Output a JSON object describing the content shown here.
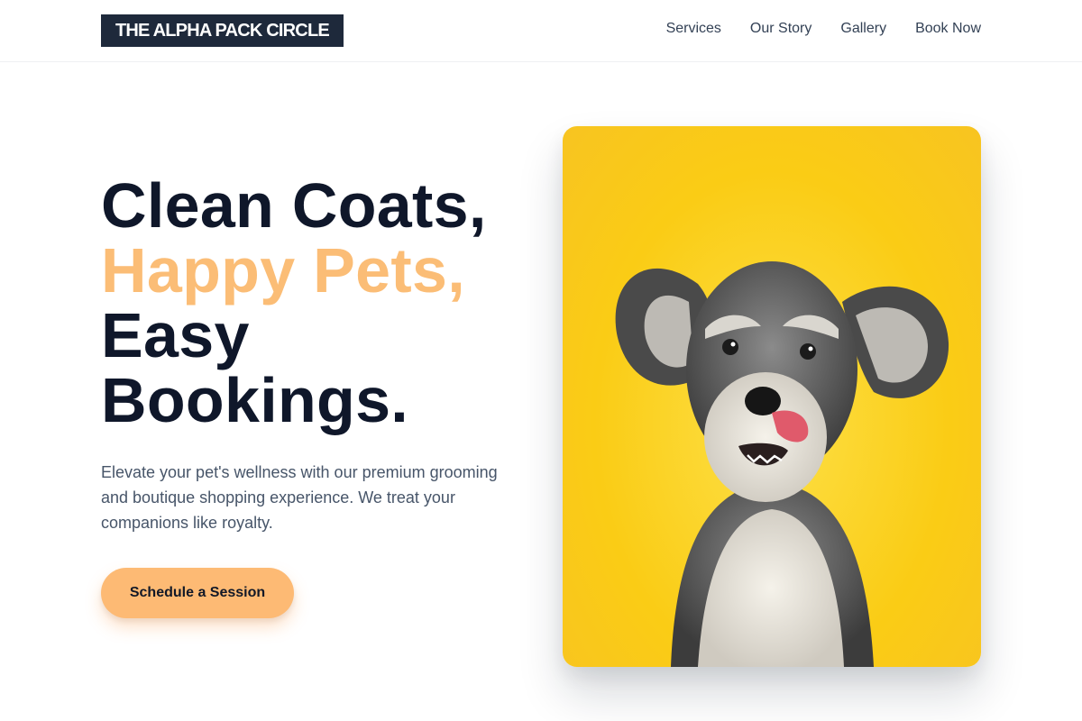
{
  "brand": {
    "name": "THE ALPHA PACK CIRCLE"
  },
  "nav": {
    "items": [
      {
        "label": "Services"
      },
      {
        "label": "Our Story"
      },
      {
        "label": "Gallery"
      },
      {
        "label": "Book Now"
      }
    ]
  },
  "hero": {
    "headline_line1": "Clean Coats,",
    "headline_line2": "Happy Pets,",
    "headline_line3": "Easy",
    "headline_line4": "Bookings.",
    "description": "Elevate your pet's wellness with our premium grooming and boutique shopping experience. We treat your companions like royalty.",
    "cta_label": "Schedule a Session",
    "image_alt": "Schnauzer puppy on yellow background"
  },
  "colors": {
    "primary_text": "#0f172a",
    "accent": "#fbbd76",
    "cta_background": "#fdba74",
    "logo_background": "#1e293b",
    "image_background": "#facc15"
  }
}
